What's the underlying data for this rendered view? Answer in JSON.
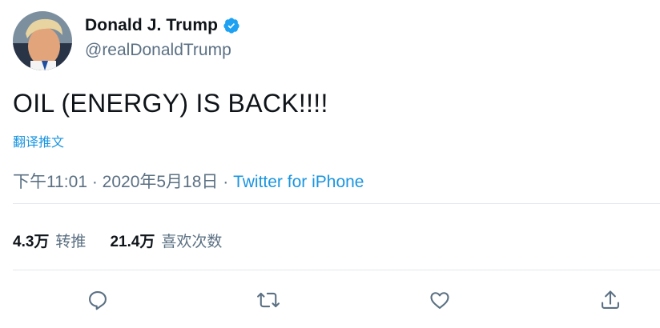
{
  "author": {
    "display_name": "Donald J. Trump",
    "handle": "@realDonaldTrump",
    "verified_icon": "verified-badge-icon",
    "avatar": "profile-photo"
  },
  "tweet": {
    "text": "OIL (ENERGY) IS BACK!!!!",
    "translate_label": "翻译推文",
    "time": "下午11:01 · 2020年5月18日 · ",
    "source": "Twitter for iPhone"
  },
  "stats": {
    "retweets_count": "4.3万",
    "retweets_label": "转推",
    "likes_count": "21.4万",
    "likes_label": "喜欢次数"
  },
  "actions": {
    "icons": [
      "reply-icon",
      "retweet-icon",
      "like-icon",
      "share-icon"
    ]
  },
  "colors": {
    "link": "#1b95e0",
    "secondary_text": "#5b7083",
    "divider": "#e1e8ed",
    "icon": "#5b7083"
  }
}
